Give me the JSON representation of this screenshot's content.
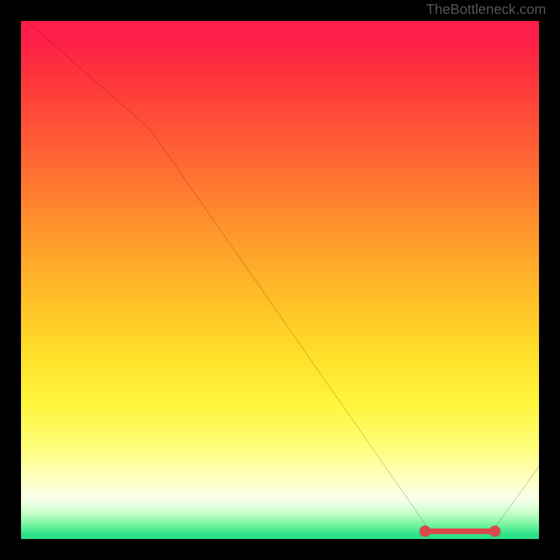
{
  "watermark": "TheBottleneck.com",
  "chart_data": {
    "type": "line",
    "title": "",
    "xlabel": "",
    "ylabel": "",
    "xlim": [
      0,
      100
    ],
    "ylim": [
      0,
      100
    ],
    "series": [
      {
        "name": "bottleneck-curve",
        "x": [
          0,
          25,
          79,
          91,
          100
        ],
        "values": [
          101,
          79,
          1.5,
          1.5,
          14
        ]
      }
    ],
    "markers": {
      "name": "highlight-band",
      "shape": "rounded-bar",
      "color": "#d84a4a",
      "y": 1.5,
      "x_start": 78,
      "x_end": 91.5,
      "endpoint_radius": 1.1
    },
    "background": {
      "type": "vertical-gradient",
      "description": "green at y=0 fading through yellow/orange to red at y=100",
      "stops": [
        {
          "y": 0,
          "color": "#2ae187"
        },
        {
          "y": 3,
          "color": "#78f5a0"
        },
        {
          "y": 7,
          "color": "#f6ffeb"
        },
        {
          "y": 11,
          "color": "#ffffc8"
        },
        {
          "y": 18,
          "color": "#fffe78"
        },
        {
          "y": 26,
          "color": "#fff53c"
        },
        {
          "y": 36,
          "color": "#ffde28"
        },
        {
          "y": 48,
          "color": "#ffba28"
        },
        {
          "y": 60,
          "color": "#ff942c"
        },
        {
          "y": 75,
          "color": "#ff6034"
        },
        {
          "y": 90,
          "color": "#ff323c"
        },
        {
          "y": 100,
          "color": "#fd1e4a"
        }
      ]
    }
  }
}
